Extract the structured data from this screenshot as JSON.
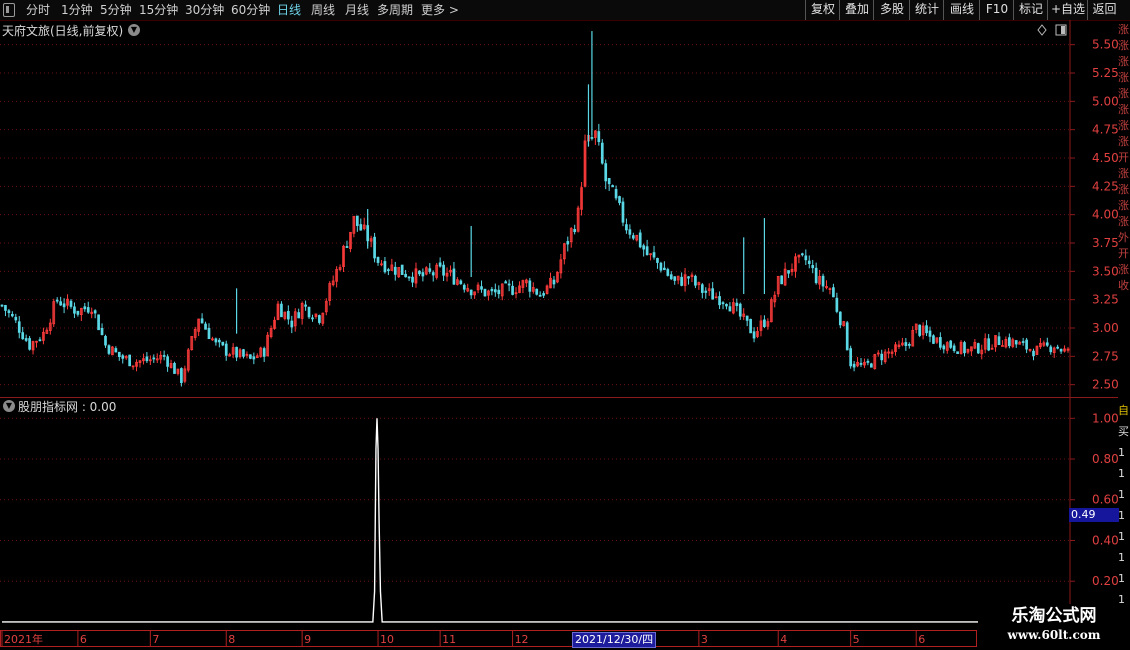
{
  "toolbar": {
    "periods": [
      "分时",
      "1分钟",
      "5分钟",
      "15分钟",
      "30分钟",
      "60分钟",
      "日线",
      "周线",
      "月线",
      "多周期",
      "更多 >"
    ],
    "active_period": "日线",
    "right_buttons": [
      "复权",
      "叠加",
      "多股",
      "统计",
      "画线",
      "F10",
      "标记",
      "+自选",
      "返回"
    ]
  },
  "main_title": "天府文旅(日线,前复权)",
  "indicator_title": "股朋指标网 : 0.00",
  "ticker_text": "涨涨涨涨涨涨涨涨开涨涨涨涨外开涨收",
  "ticker2_values": [
    "自",
    "买",
    "1",
    "1",
    "1",
    "1",
    "1",
    "1",
    "1",
    "1",
    "1"
  ],
  "watermark": {
    "line1": "乐淘公式网",
    "line2": "www.60lt.com"
  },
  "chart_data": [
    {
      "type": "candlestick",
      "title": "天府文旅(日线,前复权)",
      "y_ticks": [
        2.5,
        2.75,
        3.0,
        3.25,
        3.5,
        3.75,
        4.0,
        4.25,
        4.5,
        4.75,
        5.0,
        5.25,
        5.5
      ],
      "ylim": [
        2.4,
        5.7
      ],
      "x_labels": [
        "2021年",
        "6",
        "7",
        "8",
        "9",
        "10",
        "11",
        "12",
        "2021/12/30/四",
        "3",
        "4",
        "5",
        "6"
      ],
      "x_label_days": [
        0,
        22,
        43,
        65,
        87,
        109,
        127,
        148,
        167,
        202,
        225,
        246,
        265
      ],
      "x_range": [
        0,
        309
      ],
      "close_series": {
        "days": [
          0,
          4,
          8,
          12,
          16,
          22,
          26,
          30,
          34,
          38,
          43,
          47,
          52,
          57,
          62,
          65,
          67,
          72,
          76,
          80,
          84,
          87,
          92,
          97,
          102,
          106,
          109,
          112,
          116,
          121,
          127,
          131,
          136,
          142,
          148,
          152,
          156,
          160,
          163,
          167,
          169,
          172,
          175,
          178,
          181,
          184,
          187,
          191,
          195,
          199,
          202,
          205,
          210,
          214,
          218,
          222,
          225,
          229,
          233,
          237,
          240,
          244,
          246,
          250,
          254,
          259,
          262,
          265,
          270,
          275,
          280,
          285,
          290,
          295,
          300,
          305,
          309
        ],
        "values": [
          3.2,
          3.05,
          2.85,
          2.95,
          3.25,
          3.15,
          3.2,
          2.85,
          2.75,
          2.7,
          2.72,
          2.75,
          2.55,
          3.1,
          2.85,
          2.8,
          2.78,
          2.72,
          2.8,
          3.2,
          3.05,
          3.2,
          3.1,
          3.5,
          3.95,
          3.8,
          3.6,
          3.55,
          3.5,
          3.45,
          3.5,
          3.45,
          3.35,
          3.3,
          3.35,
          3.4,
          3.3,
          3.4,
          3.7,
          4.0,
          4.6,
          4.7,
          4.3,
          4.1,
          3.9,
          3.8,
          3.65,
          3.55,
          3.4,
          3.45,
          3.35,
          3.3,
          3.25,
          3.1,
          2.95,
          3.1,
          3.4,
          3.55,
          3.6,
          3.4,
          3.35,
          3.0,
          2.7,
          2.65,
          2.75,
          2.8,
          2.85,
          3.0,
          2.9,
          2.85,
          2.8,
          2.85,
          2.9,
          2.85,
          2.8,
          2.85,
          2.78
        ]
      },
      "spikes": [
        {
          "day": 171,
          "high": 5.62,
          "low": 4.7
        },
        {
          "day": 170,
          "high": 5.15,
          "low": 4.6
        },
        {
          "day": 68,
          "high": 3.35,
          "low": 2.95
        },
        {
          "day": 221,
          "high": 3.97,
          "low": 3.3
        },
        {
          "day": 215,
          "high": 3.8,
          "low": 3.3
        },
        {
          "day": 106,
          "high": 4.05,
          "low": 3.7
        },
        {
          "day": 136,
          "high": 3.9,
          "low": 3.45
        }
      ],
      "up_color": "#ff3b3b",
      "down_color": "#5ad8e6",
      "grid": true
    },
    {
      "type": "line",
      "title": "股朋指标网 : 0.00",
      "y_ticks": [
        0.2,
        0.4,
        0.6,
        0.8,
        1.0
      ],
      "ylim": [
        -0.02,
        1.08
      ],
      "series": [
        {
          "x": [
            0,
            107.5,
            108,
            108.4,
            108.7,
            109,
            109.3,
            109.7,
            110.2,
            309
          ],
          "y": [
            0,
            0,
            0.15,
            0.85,
            1.0,
            0.85,
            0.5,
            0.15,
            0,
            0
          ]
        }
      ],
      "line_color": "#ffffff",
      "cursor_value": "0.49",
      "grid": true
    }
  ]
}
